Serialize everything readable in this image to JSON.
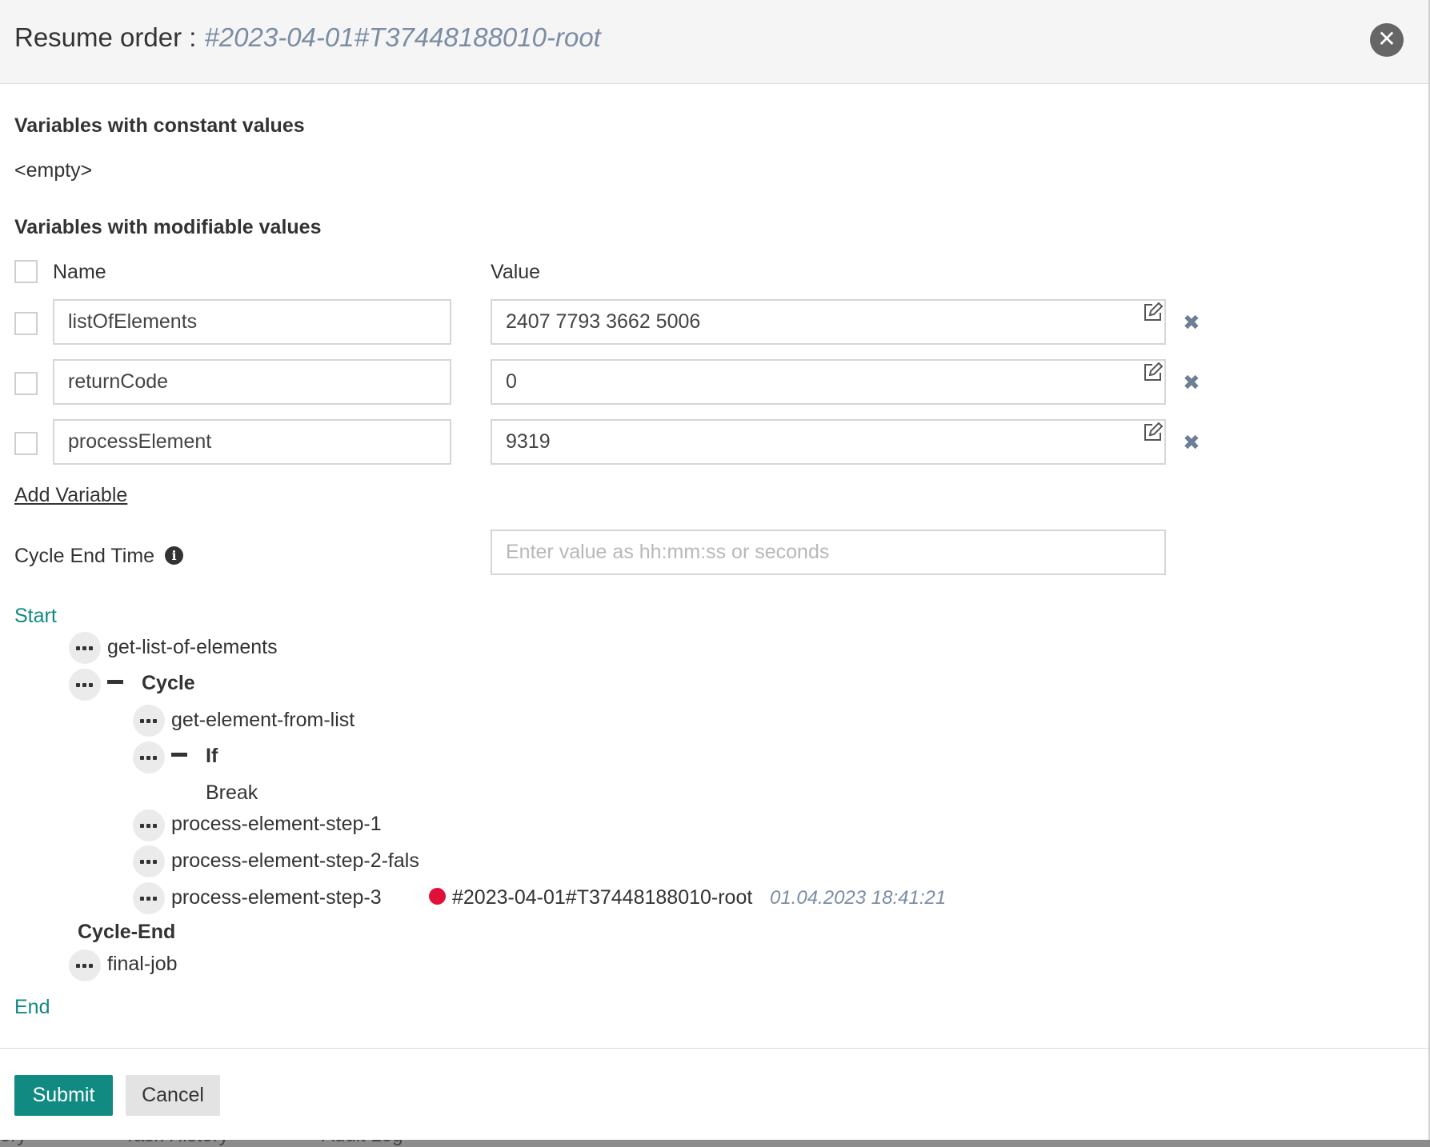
{
  "background_tabs": [
    "ory",
    "Task History",
    "Audit Log"
  ],
  "modal": {
    "title": "Resume order :",
    "order_id": "#2023-04-01#T37448188010-root",
    "close_icon": "close-circle-icon"
  },
  "constants": {
    "heading": "Variables with constant values",
    "empty_text": "<empty>"
  },
  "modifiable": {
    "heading": "Variables with modifiable values",
    "name_header": "Name",
    "value_header": "Value",
    "variables": [
      {
        "name": "listOfElements",
        "value": "2407 7793 3662 5006"
      },
      {
        "name": "returnCode",
        "value": "0"
      },
      {
        "name": "processElement",
        "value": "9319"
      }
    ],
    "add_label": "Add Variable"
  },
  "cycle_end": {
    "label": "Cycle End Time",
    "placeholder": "Enter value as hh:mm:ss or seconds",
    "info_icon": "info-icon"
  },
  "workflow": {
    "start": "Start",
    "end": "End",
    "job1": "get-list-of-elements",
    "cycle": "Cycle",
    "job2": "get-element-from-list",
    "if": "If",
    "break": "Break",
    "job3": "process-element-step-1",
    "job4": "process-element-step-2-fals",
    "job5": "process-element-step-3",
    "job5_order": "#2023-04-01#T37448188010-root",
    "job5_time": "01.04.2023 18:41:21",
    "order_status_color": "#e0103a",
    "cycle_end": "Cycle-End",
    "job6": "final-job"
  },
  "buttons": {
    "submit": "Submit",
    "cancel": "Cancel"
  },
  "colors": {
    "accent": "#118a82",
    "order_id": "#7b8da3",
    "remove_icon": "#6d7f96"
  }
}
